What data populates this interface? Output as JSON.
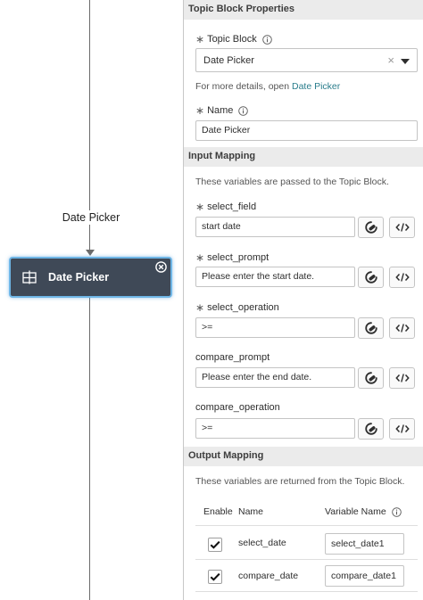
{
  "canvas": {
    "edge_label": "Date Picker",
    "node": {
      "label": "Date Picker",
      "icon": "grid-icon",
      "close_icon": "close-circle-icon"
    }
  },
  "panel": {
    "header": "Topic Block Properties",
    "topic_block": {
      "label": "Topic Block",
      "value": "Date Picker",
      "clear_glyph": "×",
      "details_text": "For more details, open",
      "details_link": "Date Picker"
    },
    "name": {
      "label": "Name",
      "value": "Date Picker"
    },
    "input_mapping": {
      "header": "Input Mapping",
      "description": "These variables are passed to the Topic Block.",
      "fields": [
        {
          "label": "select_field",
          "required": true,
          "value": "start date"
        },
        {
          "label": "select_prompt",
          "required": true,
          "value": "Please enter the start date."
        },
        {
          "label": "select_operation",
          "required": true,
          "value": ">="
        },
        {
          "label": "compare_prompt",
          "required": false,
          "value": "Please enter the end date."
        },
        {
          "label": "compare_operation",
          "required": false,
          "value": ">="
        }
      ]
    },
    "output_mapping": {
      "header": "Output Mapping",
      "description": "These variables are returned from the Topic Block.",
      "columns": {
        "enable": "Enable",
        "name": "Name",
        "variable_name": "Variable Name"
      },
      "rows": [
        {
          "enabled": true,
          "name": "select_date",
          "variable_name": "select_date1"
        },
        {
          "enabled": true,
          "name": "compare_date",
          "variable_name": "compare_date1"
        }
      ]
    }
  },
  "required_marker": "∗",
  "colors": {
    "node_bg": "#3f4957",
    "node_border": "#6fb6e6",
    "link": "#2a7d8c",
    "header_bg": "#ebebeb"
  }
}
